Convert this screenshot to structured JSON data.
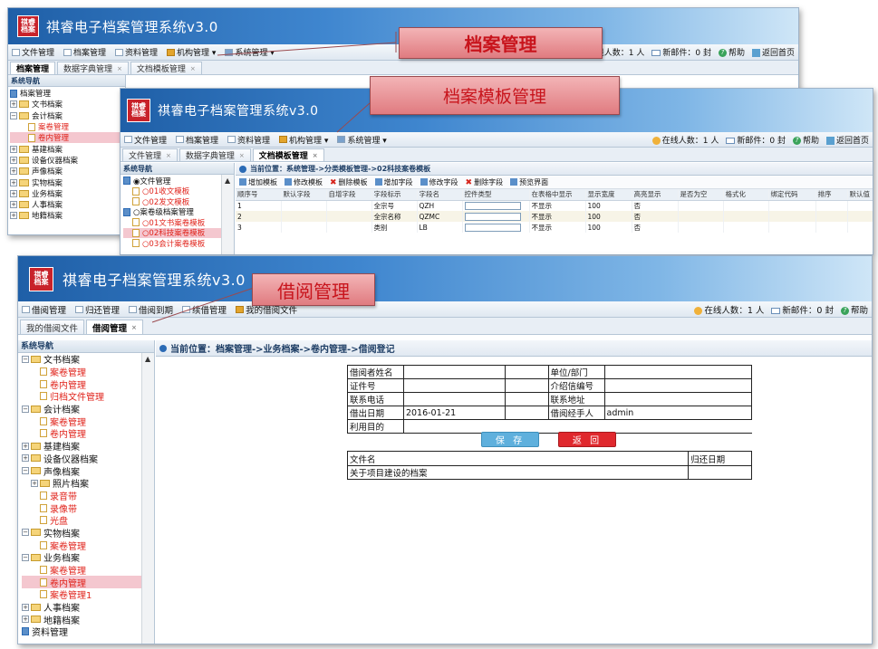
{
  "app": {
    "title": "祺睿电子档案管理系统v3.0",
    "logo_text": "祺睿 档案"
  },
  "callouts": {
    "archive": "档案管理",
    "template": "档案模板管理",
    "borrow": "借阅管理"
  },
  "status": {
    "online": "在线人数：1 人",
    "mail": "新邮件：0 封",
    "help": "帮助",
    "back_home": "返回首页"
  },
  "w1": {
    "menu": [
      "文件管理",
      "档案管理",
      "资料管理",
      "机构管理 ▾",
      "系统管理 ▾"
    ],
    "tabs": [
      {
        "label": "档案管理"
      },
      {
        "label": "数据字典管理",
        "close": "×"
      },
      {
        "label": "文档模板管理",
        "close": "×"
      }
    ],
    "sidebar_title": "系统导航",
    "tree": [
      {
        "label": "档案管理",
        "kind": "root"
      },
      {
        "label": "文书档案",
        "kind": "folder",
        "exp": "+"
      },
      {
        "label": "会计档案",
        "kind": "folder",
        "exp": "−"
      },
      {
        "label": "案卷管理",
        "kind": "doc",
        "indent": 2,
        "red": true
      },
      {
        "label": "卷内管理",
        "kind": "doc",
        "indent": 2,
        "red": true,
        "hl": true
      },
      {
        "label": "基建档案",
        "kind": "folder",
        "exp": "+"
      },
      {
        "label": "设备仪器档案",
        "kind": "folder",
        "exp": "+"
      },
      {
        "label": "声像档案",
        "kind": "folder",
        "exp": "+"
      },
      {
        "label": "实物档案",
        "kind": "folder",
        "exp": "+"
      },
      {
        "label": "业务档案",
        "kind": "folder",
        "exp": "+"
      },
      {
        "label": "人事档案",
        "kind": "folder",
        "exp": "+"
      },
      {
        "label": "地籍档案",
        "kind": "folder",
        "exp": "+"
      }
    ]
  },
  "w2": {
    "menu": [
      "文件管理",
      "档案管理",
      "资料管理",
      "机构管理 ▾",
      "系统管理 ▾"
    ],
    "tabs": [
      {
        "label": "文件管理",
        "close": "×"
      },
      {
        "label": "数据字典管理",
        "close": "×"
      },
      {
        "label": "文档模板管理",
        "close": "×"
      }
    ],
    "sidebar_title": "系统导航",
    "tree": [
      {
        "label": "◉文件管理",
        "kind": "root"
      },
      {
        "label": "○01收文模板",
        "kind": "doc",
        "indent": 1,
        "red": true
      },
      {
        "label": "○02发文模板",
        "kind": "doc",
        "indent": 1,
        "red": true
      },
      {
        "label": "○案卷级档案管理",
        "kind": "root"
      },
      {
        "label": "○01文书案卷模板",
        "kind": "doc",
        "indent": 1,
        "red": true
      },
      {
        "label": "○02科技案卷模板",
        "kind": "doc",
        "indent": 1,
        "red": true,
        "hl": true
      },
      {
        "label": "○03会计案卷模板",
        "kind": "doc",
        "indent": 1,
        "red": true
      }
    ],
    "crumb": "当前位置：系统管理->分类模板管理->02科技案卷模板",
    "toolbar": [
      "增加模板",
      "修改模板",
      "删除模板",
      "增加字段",
      "修改字段",
      "删除字段",
      "预览界面"
    ],
    "columns": [
      "顺序号",
      "默认字段",
      "自增字段",
      "字段标示",
      "字段名",
      "控件类型",
      "在表格中显示",
      "显示宽度",
      "高亮显示",
      "是否为空",
      "格式化",
      "绑定代码",
      "排序",
      "默认值"
    ],
    "rows": [
      {
        "seq": "1",
        "label": "全宗号",
        "name": "QZH",
        "show": "不显示",
        "width": "100",
        "hi": "否"
      },
      {
        "seq": "2",
        "label": "全宗名称",
        "name": "QZMC",
        "show": "不显示",
        "width": "100",
        "hi": "否"
      },
      {
        "seq": "3",
        "label": "类别",
        "name": "LB",
        "show": "不显示",
        "width": "100",
        "hi": "否"
      }
    ]
  },
  "w3": {
    "menu": [
      "借阅管理",
      "归还管理",
      "借阅到期",
      "续借管理",
      "我的借阅文件"
    ],
    "tabs": [
      {
        "label": "我的借阅文件"
      },
      {
        "label": "借阅管理",
        "close": "×"
      }
    ],
    "sidebar_title": "系统导航",
    "tree": [
      {
        "label": "文书档案",
        "kind": "folder",
        "exp": "−"
      },
      {
        "label": "案卷管理",
        "kind": "doc",
        "indent": 2,
        "red": true
      },
      {
        "label": "卷内管理",
        "kind": "doc",
        "indent": 2,
        "red": true
      },
      {
        "label": "归档文件管理",
        "kind": "doc",
        "indent": 2,
        "red": true
      },
      {
        "label": "会计档案",
        "kind": "folder",
        "exp": "−"
      },
      {
        "label": "案卷管理",
        "kind": "doc",
        "indent": 2,
        "red": true
      },
      {
        "label": "卷内管理",
        "kind": "doc",
        "indent": 2,
        "red": true
      },
      {
        "label": "基建档案",
        "kind": "folder",
        "exp": "+"
      },
      {
        "label": "设备仪器档案",
        "kind": "folder",
        "exp": "+"
      },
      {
        "label": "声像档案",
        "kind": "folder",
        "exp": "−"
      },
      {
        "label": "照片档案",
        "kind": "folder",
        "exp": "+",
        "indent": 1
      },
      {
        "label": "录音带",
        "kind": "doc",
        "indent": 2,
        "red": true
      },
      {
        "label": "录像带",
        "kind": "doc",
        "indent": 2,
        "red": true
      },
      {
        "label": "光盘",
        "kind": "doc",
        "indent": 2,
        "red": true
      },
      {
        "label": "实物档案",
        "kind": "folder",
        "exp": "−"
      },
      {
        "label": "案卷管理",
        "kind": "doc",
        "indent": 2,
        "red": true
      },
      {
        "label": "业务档案",
        "kind": "folder",
        "exp": "−"
      },
      {
        "label": "案卷管理",
        "kind": "doc",
        "indent": 2,
        "red": true
      },
      {
        "label": "卷内管理",
        "kind": "doc",
        "indent": 2,
        "red": true,
        "hl": true
      },
      {
        "label": "案卷管理1",
        "kind": "doc",
        "indent": 2,
        "red": true
      },
      {
        "label": "人事档案",
        "kind": "folder",
        "exp": "+"
      },
      {
        "label": "地籍档案",
        "kind": "folder",
        "exp": "+"
      },
      {
        "label": "资料管理",
        "kind": "root"
      }
    ],
    "crumb": "当前位置：档案管理->业务档案->卷内管理->借阅登记",
    "form": {
      "borrower_name": "借阅者姓名",
      "unit": "单位/部门",
      "id_no": "证件号",
      "letter_no": "介绍信编号",
      "phone": "联系电话",
      "address": "联系地址",
      "borrow_date": "借出日期",
      "borrow_date_value": "2016-01-21",
      "handler": "借阅经手人",
      "handler_value": "admin",
      "purpose": "利用目的",
      "save": "保 存",
      "back": "返 回",
      "file_col": "文件名",
      "return_col": "归还日期",
      "file_row": "关于项目建设的档案"
    }
  }
}
